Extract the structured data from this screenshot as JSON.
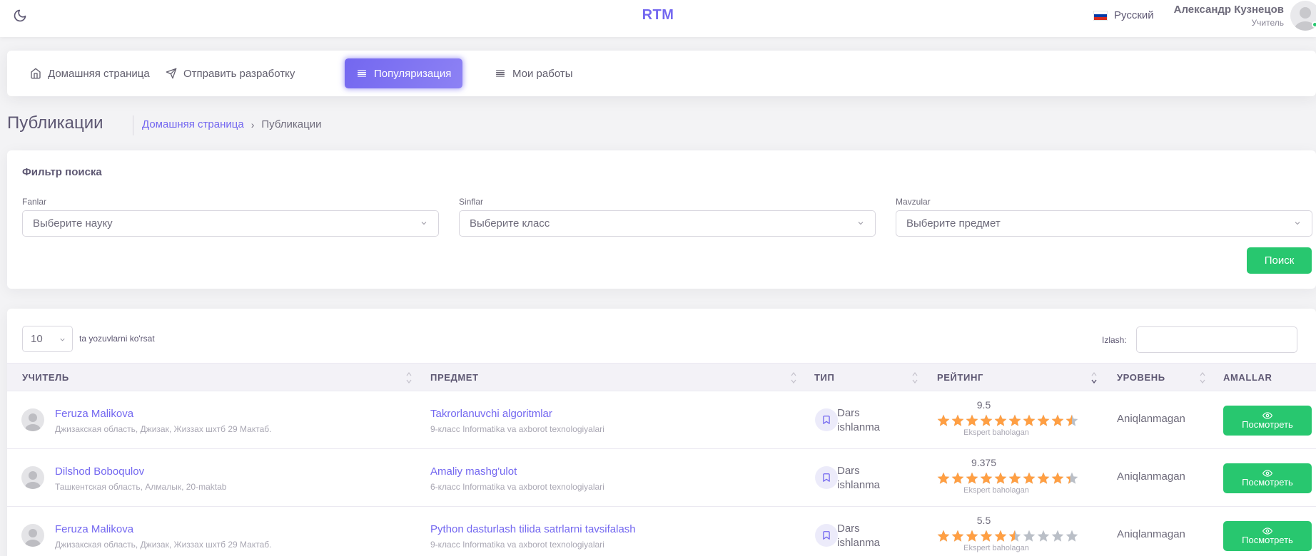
{
  "header": {
    "brand": "RTM",
    "language": "Русский",
    "user_name": "Александр Кузнецов",
    "user_role": "Учитель"
  },
  "nav": [
    {
      "label": "Домашняя страница",
      "icon": "home-icon",
      "active": false
    },
    {
      "label": "Отправить разработку",
      "icon": "send-icon",
      "active": false
    },
    {
      "label": "Популяризация",
      "icon": "list-icon",
      "active": true
    },
    {
      "label": "Мои работы",
      "icon": "list-icon",
      "active": false
    }
  ],
  "page": {
    "title": "Публикации",
    "breadcrumb_home": "Домашняя страница",
    "breadcrumb_current": "Публикации"
  },
  "filter": {
    "title": "Фильтр поиска",
    "fields": [
      {
        "label": "Fanlar",
        "placeholder": "Выберите науку"
      },
      {
        "label": "Sinflar",
        "placeholder": "Выберите класс"
      },
      {
        "label": "Mavzular",
        "placeholder": "Выберите предмет"
      }
    ],
    "search_button": "Поиск"
  },
  "table": {
    "page_length": "10",
    "page_length_label": "ta yozuvlarni ko'rsat",
    "search_label": "Izlash:",
    "columns": [
      "УЧИТЕЛЬ",
      "ПРЕДМЕТ",
      "ТИП",
      "РЕЙТИНГ",
      "УРОВЕНЬ",
      "AMALLAR"
    ],
    "rows": [
      {
        "teacher": "Feruza Malikova",
        "location": "Джизакская область, Джизак, Жиззах шхтб 29 Мактаб.",
        "subject": "Takrorlanuvchi algoritmlar",
        "subject_sub": "9-класс Informatika va axborot texnologiyalari",
        "type": "Dars ishlanma",
        "rating": "9.5",
        "rating_value": 9.5,
        "rating_note": "Ekspert baholagan",
        "level": "Aniqlanmagan",
        "action": "Посмотреть"
      },
      {
        "teacher": "Dilshod Boboqulov",
        "location": "Ташкентская область, Алмалык, 20-maktab",
        "subject": "Amaliy mashg'ulot",
        "subject_sub": "6-класс Informatika va axborot texnologiyalari",
        "type": "Dars ishlanma",
        "rating": "9.375",
        "rating_value": 9.375,
        "rating_note": "Ekspert baholagan",
        "level": "Aniqlanmagan",
        "action": "Посмотреть"
      },
      {
        "teacher": "Feruza Malikova",
        "location": "Джизакская область, Джизак, Жиззах шхтб 29 Мактаб.",
        "subject": "Python dasturlash tilida satrlarni tavsifalash",
        "subject_sub": "9-класс Informatika va axborot texnologiyalari",
        "type": "Dars ishlanma",
        "rating": "5.5",
        "rating_value": 5.5,
        "rating_note": "Ekspert baholagan",
        "level": "Aniqlanmagan",
        "action": "Посмотреть"
      }
    ]
  },
  "colors": {
    "primary": "#7367f0",
    "success": "#28c76f",
    "star_filled": "#ff9f43",
    "star_empty": "#babfc7"
  }
}
